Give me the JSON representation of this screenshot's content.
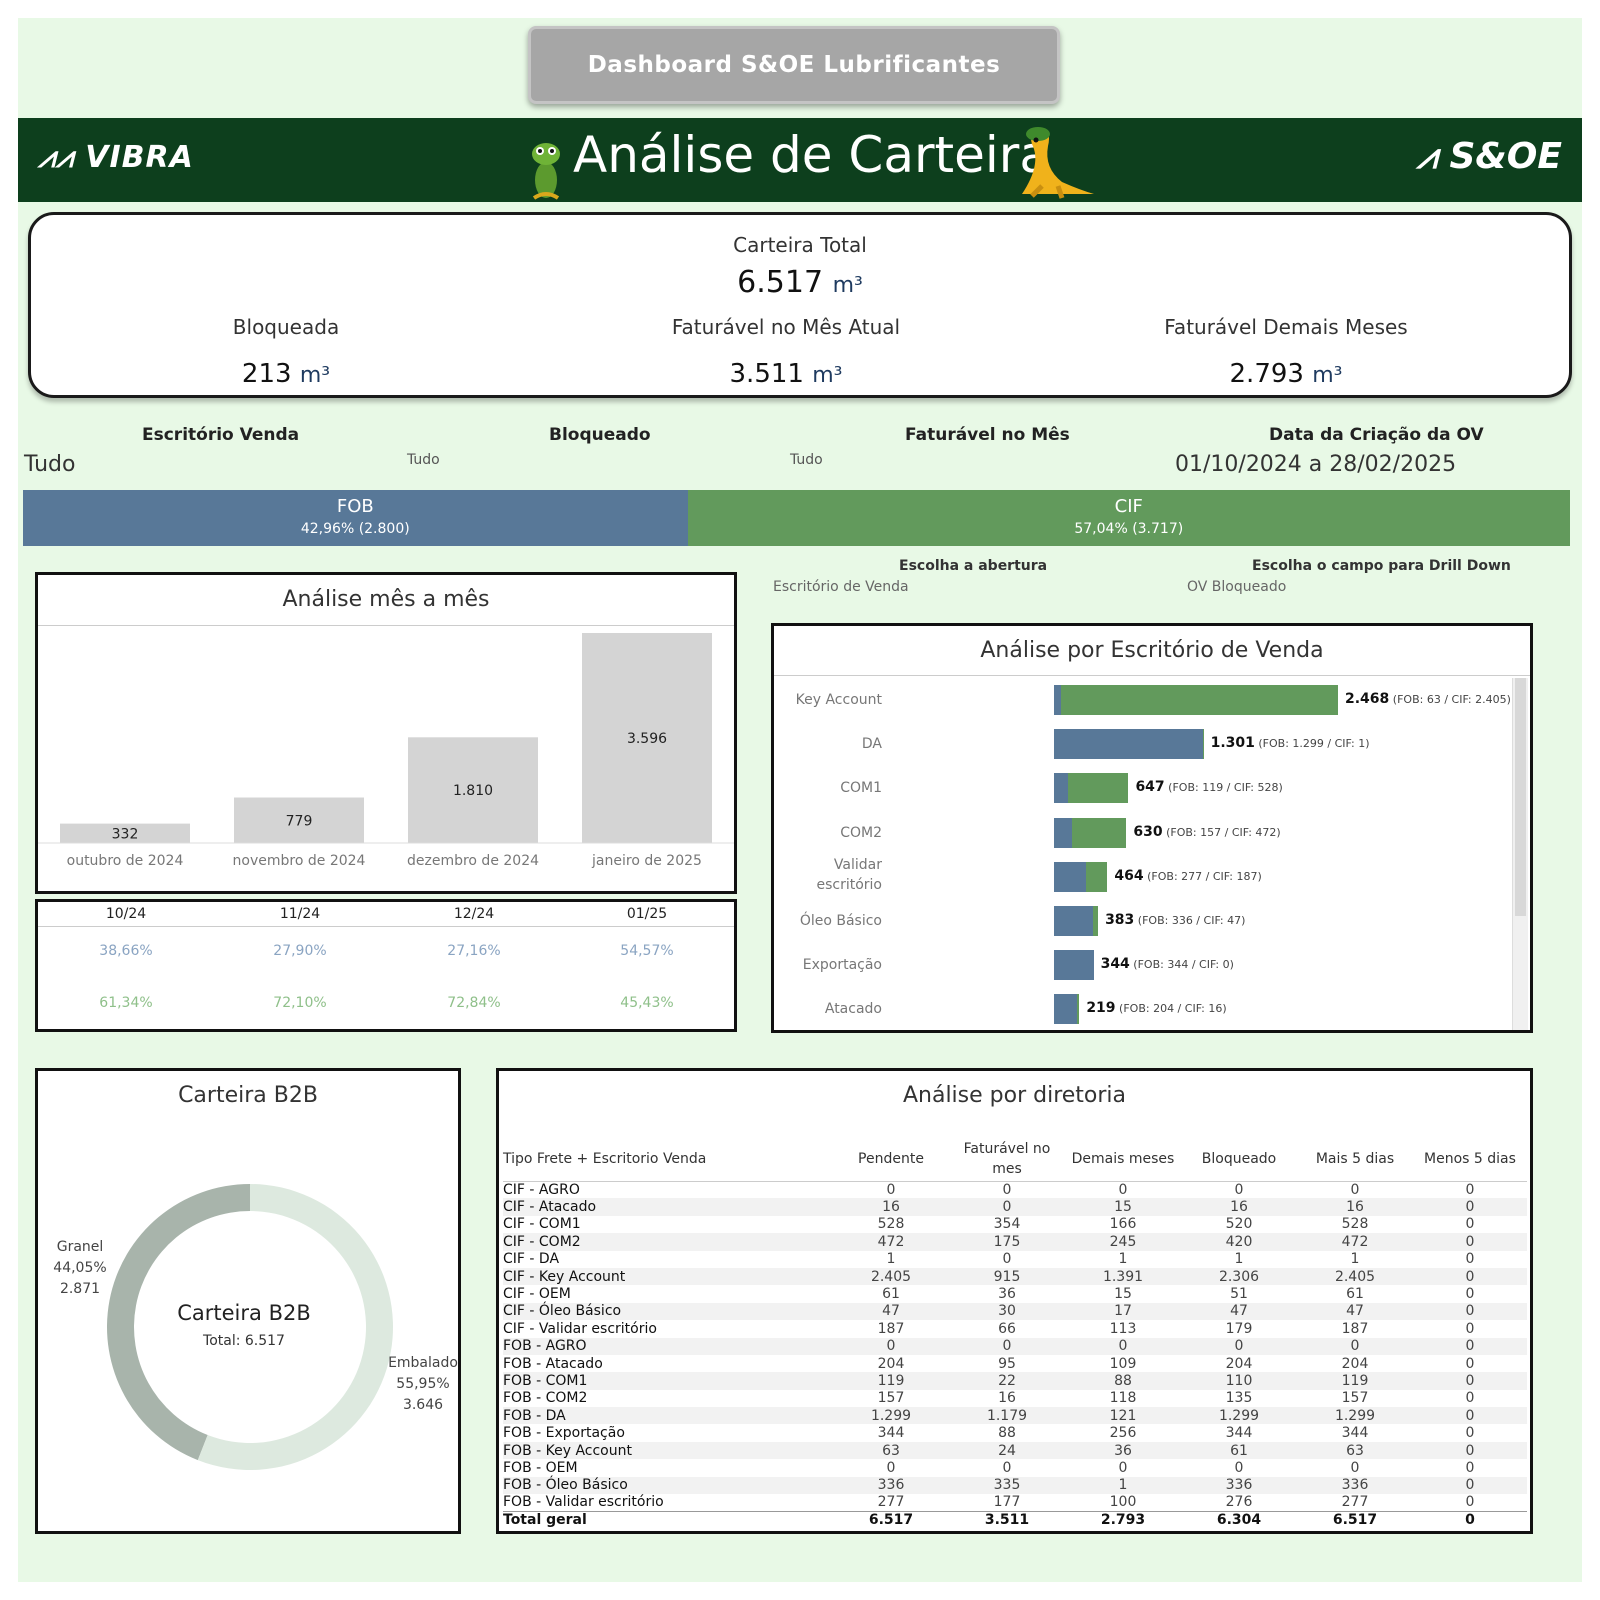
{
  "header": {
    "dashboard_button": "Dashboard S&OE Lubrificantes",
    "title": "Análise de Carteira",
    "logo_left": "VIBRA",
    "logo_right": "S&OE"
  },
  "kpis": {
    "total_label": "Carteira Total",
    "total_value": "6.517",
    "unit": "m³",
    "blocked_label": "Bloqueada",
    "blocked_value": "213",
    "current_label": "Faturável no Mês Atual",
    "current_value": "3.511",
    "other_label": "Faturável Demais Meses",
    "other_value": "2.793"
  },
  "filters": {
    "office_label": "Escritório Venda",
    "office_value": "Tudo",
    "blocked_label": "Bloqueado",
    "blocked_value": "Tudo",
    "billable_label": "Faturável no Mês",
    "billable_value": "Tudo",
    "date_label": "Data da Criação da OV",
    "date_value": "01/10/2024 a 28/02/2025"
  },
  "split": {
    "fob_label": "FOB",
    "fob_detail": "42,96% (2.800)",
    "fob_share": 42.96,
    "cif_label": "CIF",
    "cif_detail": "57,04% (3.717)",
    "cif_share": 57.04
  },
  "colors": {
    "fob": "#587898",
    "cif": "#629a5c",
    "month_bar": "#d4d4d4",
    "donut_granel": "#a8b4ab",
    "donut_embalado": "#dde9df"
  },
  "monthly": {
    "title": "Análise mês a mês",
    "columns": [
      "10/24",
      "11/24",
      "12/24",
      "01/25"
    ],
    "fob_pct": [
      "38,66%",
      "27,90%",
      "27,16%",
      "54,57%"
    ],
    "cif_pct": [
      "61,34%",
      "72,10%",
      "72,84%",
      "45,43%"
    ]
  },
  "drill": {
    "opening_label": "Escolha a abertura",
    "opening_value": "Escritório de Venda",
    "field_label": "Escolha o campo para Drill Down",
    "field_value": "OV Bloqueado"
  },
  "office": {
    "title": "Análise por Escritório de Venda",
    "rows": [
      {
        "name": "Key Account",
        "total": "2.468",
        "detail": "(FOB: 63 / CIF: 2.405)",
        "fob": 63,
        "cif": 2405
      },
      {
        "name": "DA",
        "total": "1.301",
        "detail": "(FOB: 1.299 / CIF: 1)",
        "fob": 1299,
        "cif": 1
      },
      {
        "name": "COM1",
        "total": "647",
        "detail": "(FOB: 119 / CIF: 528)",
        "fob": 119,
        "cif": 528
      },
      {
        "name": "COM2",
        "total": "630",
        "detail": "(FOB: 157 / CIF: 472)",
        "fob": 157,
        "cif": 472
      },
      {
        "name": "Validar escritório",
        "total": "464",
        "detail": "(FOB: 277 / CIF: 187)",
        "fob": 277,
        "cif": 187
      },
      {
        "name": "Óleo Básico",
        "total": "383",
        "detail": "(FOB: 336 / CIF: 47)",
        "fob": 336,
        "cif": 47
      },
      {
        "name": "Exportação",
        "total": "344",
        "detail": "(FOB: 344 / CIF: 0)",
        "fob": 344,
        "cif": 0
      },
      {
        "name": "Atacado",
        "total": "219",
        "detail": "(FOB: 204 / CIF: 16)",
        "fob": 204,
        "cif": 16
      }
    ]
  },
  "b2b": {
    "title": "Carteira B2B",
    "center_title": "Carteira B2B",
    "center_total": "Total: 6.517",
    "granel_name": "Granel",
    "granel_pct": "44,05%",
    "granel_val": "2.871",
    "embalado_name": "Embalado",
    "embalado_pct": "55,95%",
    "embalado_val": "3.646"
  },
  "directorate": {
    "title": "Análise por diretoria",
    "headers": [
      "Tipo Frete + Escritorio Venda",
      "Pendente",
      "Faturável no mes",
      "Demais meses",
      "Bloqueado",
      "Mais 5 dias",
      "Menos 5 dias"
    ],
    "rows": [
      [
        "CIF - AGRO",
        "0",
        "0",
        "0",
        "0",
        "0",
        "0"
      ],
      [
        "CIF - Atacado",
        "16",
        "0",
        "15",
        "16",
        "16",
        "0"
      ],
      [
        "CIF - COM1",
        "528",
        "354",
        "166",
        "520",
        "528",
        "0"
      ],
      [
        "CIF - COM2",
        "472",
        "175",
        "245",
        "420",
        "472",
        "0"
      ],
      [
        "CIF - DA",
        "1",
        "0",
        "1",
        "1",
        "1",
        "0"
      ],
      [
        "CIF - Key Account",
        "2.405",
        "915",
        "1.391",
        "2.306",
        "2.405",
        "0"
      ],
      [
        "CIF - OEM",
        "61",
        "36",
        "15",
        "51",
        "61",
        "0"
      ],
      [
        "CIF - Óleo Básico",
        "47",
        "30",
        "17",
        "47",
        "47",
        "0"
      ],
      [
        "CIF - Validar escritório",
        "187",
        "66",
        "113",
        "179",
        "187",
        "0"
      ],
      [
        "FOB - AGRO",
        "0",
        "0",
        "0",
        "0",
        "0",
        "0"
      ],
      [
        "FOB - Atacado",
        "204",
        "95",
        "109",
        "204",
        "204",
        "0"
      ],
      [
        "FOB - COM1",
        "119",
        "22",
        "88",
        "110",
        "119",
        "0"
      ],
      [
        "FOB - COM2",
        "157",
        "16",
        "118",
        "135",
        "157",
        "0"
      ],
      [
        "FOB - DA",
        "1.299",
        "1.179",
        "121",
        "1.299",
        "1.299",
        "0"
      ],
      [
        "FOB - Exportação",
        "344",
        "88",
        "256",
        "344",
        "344",
        "0"
      ],
      [
        "FOB - Key Account",
        "63",
        "24",
        "36",
        "61",
        "63",
        "0"
      ],
      [
        "FOB - OEM",
        "0",
        "0",
        "0",
        "0",
        "0",
        "0"
      ],
      [
        "FOB - Óleo Básico",
        "336",
        "335",
        "1",
        "336",
        "336",
        "0"
      ],
      [
        "FOB - Validar escritório",
        "277",
        "177",
        "100",
        "276",
        "277",
        "0"
      ]
    ],
    "total": [
      "Total geral",
      "6.517",
      "3.511",
      "2.793",
      "6.304",
      "6.517",
      "0"
    ]
  },
  "chart_data": [
    {
      "type": "bar",
      "title": "Análise mês a mês",
      "categories": [
        "outubro de 2024",
        "novembro de 2024",
        "dezembro de 2024",
        "janeiro de 2025"
      ],
      "values": [
        332,
        779,
        1810,
        3596
      ],
      "value_labels": [
        "332",
        "779",
        "1.810",
        "3.596"
      ],
      "ylim": [
        0,
        3596
      ]
    },
    {
      "type": "bar",
      "title": "Análise por Escritório de Venda",
      "orientation": "horizontal",
      "categories": [
        "Key Account",
        "DA",
        "COM1",
        "COM2",
        "Validar escritório",
        "Óleo Básico",
        "Exportação",
        "Atacado"
      ],
      "series": [
        {
          "name": "FOB",
          "values": [
            63,
            1299,
            119,
            157,
            277,
            336,
            344,
            204
          ]
        },
        {
          "name": "CIF",
          "values": [
            2405,
            1,
            528,
            472,
            187,
            47,
            0,
            16
          ]
        }
      ]
    },
    {
      "type": "pie",
      "title": "Carteira B2B",
      "categories": [
        "Granel",
        "Embalado"
      ],
      "values": [
        2871,
        3646
      ]
    }
  ]
}
